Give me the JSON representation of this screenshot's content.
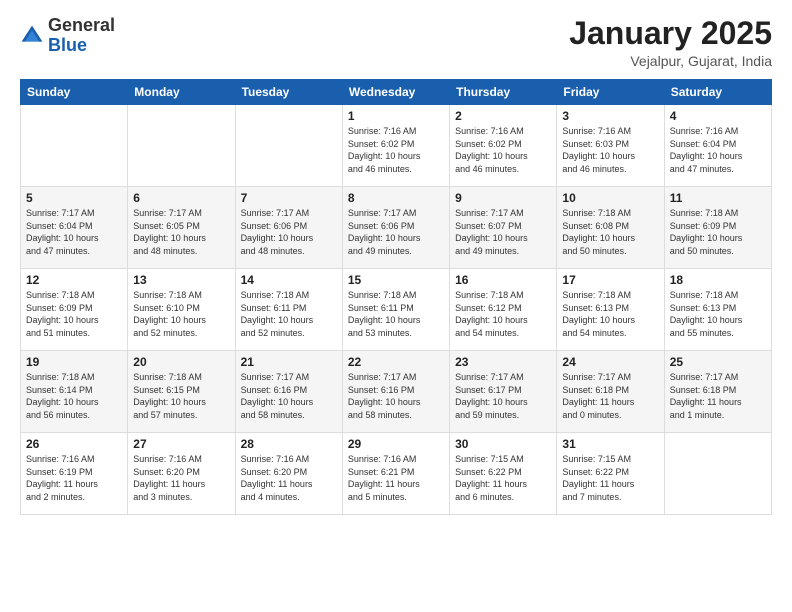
{
  "header": {
    "logo_general": "General",
    "logo_blue": "Blue",
    "title": "January 2025",
    "subtitle": "Vejalpur, Gujarat, India"
  },
  "weekdays": [
    "Sunday",
    "Monday",
    "Tuesday",
    "Wednesday",
    "Thursday",
    "Friday",
    "Saturday"
  ],
  "weeks": [
    [
      {
        "day": "",
        "info": ""
      },
      {
        "day": "",
        "info": ""
      },
      {
        "day": "",
        "info": ""
      },
      {
        "day": "1",
        "info": "Sunrise: 7:16 AM\nSunset: 6:02 PM\nDaylight: 10 hours\nand 46 minutes."
      },
      {
        "day": "2",
        "info": "Sunrise: 7:16 AM\nSunset: 6:02 PM\nDaylight: 10 hours\nand 46 minutes."
      },
      {
        "day": "3",
        "info": "Sunrise: 7:16 AM\nSunset: 6:03 PM\nDaylight: 10 hours\nand 46 minutes."
      },
      {
        "day": "4",
        "info": "Sunrise: 7:16 AM\nSunset: 6:04 PM\nDaylight: 10 hours\nand 47 minutes."
      }
    ],
    [
      {
        "day": "5",
        "info": "Sunrise: 7:17 AM\nSunset: 6:04 PM\nDaylight: 10 hours\nand 47 minutes."
      },
      {
        "day": "6",
        "info": "Sunrise: 7:17 AM\nSunset: 6:05 PM\nDaylight: 10 hours\nand 48 minutes."
      },
      {
        "day": "7",
        "info": "Sunrise: 7:17 AM\nSunset: 6:06 PM\nDaylight: 10 hours\nand 48 minutes."
      },
      {
        "day": "8",
        "info": "Sunrise: 7:17 AM\nSunset: 6:06 PM\nDaylight: 10 hours\nand 49 minutes."
      },
      {
        "day": "9",
        "info": "Sunrise: 7:17 AM\nSunset: 6:07 PM\nDaylight: 10 hours\nand 49 minutes."
      },
      {
        "day": "10",
        "info": "Sunrise: 7:18 AM\nSunset: 6:08 PM\nDaylight: 10 hours\nand 50 minutes."
      },
      {
        "day": "11",
        "info": "Sunrise: 7:18 AM\nSunset: 6:09 PM\nDaylight: 10 hours\nand 50 minutes."
      }
    ],
    [
      {
        "day": "12",
        "info": "Sunrise: 7:18 AM\nSunset: 6:09 PM\nDaylight: 10 hours\nand 51 minutes."
      },
      {
        "day": "13",
        "info": "Sunrise: 7:18 AM\nSunset: 6:10 PM\nDaylight: 10 hours\nand 52 minutes."
      },
      {
        "day": "14",
        "info": "Sunrise: 7:18 AM\nSunset: 6:11 PM\nDaylight: 10 hours\nand 52 minutes."
      },
      {
        "day": "15",
        "info": "Sunrise: 7:18 AM\nSunset: 6:11 PM\nDaylight: 10 hours\nand 53 minutes."
      },
      {
        "day": "16",
        "info": "Sunrise: 7:18 AM\nSunset: 6:12 PM\nDaylight: 10 hours\nand 54 minutes."
      },
      {
        "day": "17",
        "info": "Sunrise: 7:18 AM\nSunset: 6:13 PM\nDaylight: 10 hours\nand 54 minutes."
      },
      {
        "day": "18",
        "info": "Sunrise: 7:18 AM\nSunset: 6:13 PM\nDaylight: 10 hours\nand 55 minutes."
      }
    ],
    [
      {
        "day": "19",
        "info": "Sunrise: 7:18 AM\nSunset: 6:14 PM\nDaylight: 10 hours\nand 56 minutes."
      },
      {
        "day": "20",
        "info": "Sunrise: 7:18 AM\nSunset: 6:15 PM\nDaylight: 10 hours\nand 57 minutes."
      },
      {
        "day": "21",
        "info": "Sunrise: 7:17 AM\nSunset: 6:16 PM\nDaylight: 10 hours\nand 58 minutes."
      },
      {
        "day": "22",
        "info": "Sunrise: 7:17 AM\nSunset: 6:16 PM\nDaylight: 10 hours\nand 58 minutes."
      },
      {
        "day": "23",
        "info": "Sunrise: 7:17 AM\nSunset: 6:17 PM\nDaylight: 10 hours\nand 59 minutes."
      },
      {
        "day": "24",
        "info": "Sunrise: 7:17 AM\nSunset: 6:18 PM\nDaylight: 11 hours\nand 0 minutes."
      },
      {
        "day": "25",
        "info": "Sunrise: 7:17 AM\nSunset: 6:18 PM\nDaylight: 11 hours\nand 1 minute."
      }
    ],
    [
      {
        "day": "26",
        "info": "Sunrise: 7:16 AM\nSunset: 6:19 PM\nDaylight: 11 hours\nand 2 minutes."
      },
      {
        "day": "27",
        "info": "Sunrise: 7:16 AM\nSunset: 6:20 PM\nDaylight: 11 hours\nand 3 minutes."
      },
      {
        "day": "28",
        "info": "Sunrise: 7:16 AM\nSunset: 6:20 PM\nDaylight: 11 hours\nand 4 minutes."
      },
      {
        "day": "29",
        "info": "Sunrise: 7:16 AM\nSunset: 6:21 PM\nDaylight: 11 hours\nand 5 minutes."
      },
      {
        "day": "30",
        "info": "Sunrise: 7:15 AM\nSunset: 6:22 PM\nDaylight: 11 hours\nand 6 minutes."
      },
      {
        "day": "31",
        "info": "Sunrise: 7:15 AM\nSunset: 6:22 PM\nDaylight: 11 hours\nand 7 minutes."
      },
      {
        "day": "",
        "info": ""
      }
    ]
  ]
}
